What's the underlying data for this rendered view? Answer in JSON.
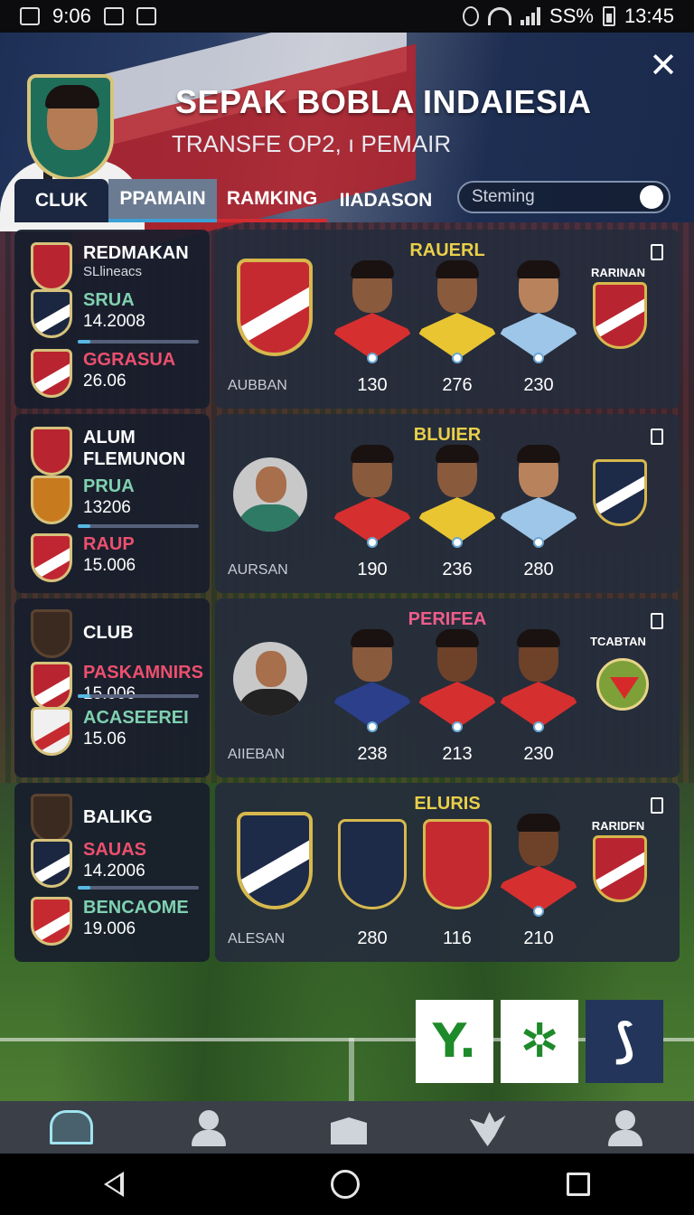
{
  "status_bar": {
    "time_left": "9:06",
    "battery": "SS%",
    "time_right": "13:45"
  },
  "header": {
    "title": "SEPAK BOBLA INDAIESIA",
    "subtitle": "TRANSFE OP2, ı PEMAIR",
    "tabs": [
      "CLUK",
      "PPAMAIN",
      "RAMKING",
      "IIADASON"
    ],
    "toggle_label": "Steming",
    "toggle_on": true
  },
  "rows": [
    {
      "left": [
        {
          "name": "REDMAKAN",
          "sub": "SLlineacs",
          "color": "#b82530"
        },
        {
          "name": "SRUA",
          "value": "14.2008",
          "name_color": "green",
          "color": "#1b2740"
        },
        {
          "name": "GGRASUA",
          "value": "26.06",
          "name_color": "pink",
          "color": "#b82530"
        }
      ],
      "right": {
        "title": "RAUERL",
        "caption": "AUBBAN",
        "club": "RARINAN",
        "numbers": [
          "130",
          "276",
          "230"
        ]
      }
    },
    {
      "left": [
        {
          "name": "ALUM",
          "sub": "FLEMUNON",
          "color": "#b82530"
        },
        {
          "name": "PRUA",
          "value": "13206",
          "name_color": "green",
          "color": "#c87a1e"
        },
        {
          "name": "RAUP",
          "value": "15.006",
          "name_color": "pink",
          "color": "#c02631"
        }
      ],
      "right": {
        "title": "BLUIER",
        "caption": "AURSAN",
        "club": "",
        "numbers": [
          "190",
          "236",
          "280"
        ]
      }
    },
    {
      "left": [
        {
          "name": "CLUB",
          "sub": "",
          "color": "#3a2a20"
        },
        {
          "name": "PASKAMNIRS",
          "value": "15.006",
          "name_color": "pink",
          "color": "#b82530"
        },
        {
          "name": "ACASEEREI",
          "value": "15.06",
          "name_color": "green",
          "color": "#f0f0f0"
        }
      ],
      "right": {
        "title": "PERIFEA",
        "caption": "AIIEBAN",
        "club": "TCABTAN",
        "numbers": [
          "238",
          "213",
          "230"
        ]
      }
    },
    {
      "left": [
        {
          "name": "BALIKG",
          "sub": "",
          "color": "#3a2a20"
        },
        {
          "name": "SAUAS",
          "value": "14.2006",
          "name_color": "pink",
          "color": "#1b2740"
        },
        {
          "name": "BENCAOME",
          "value": "19.006",
          "name_color": "green",
          "color": "#c62a31"
        }
      ],
      "right": {
        "title": "ELURIS",
        "caption": "ALESAN",
        "club": "RARIDFN",
        "numbers": [
          "280",
          "116",
          "210"
        ]
      }
    }
  ],
  "actions": [
    {
      "glyph": "Y."
    },
    {
      "glyph": "✲"
    },
    {
      "glyph": "⟆"
    }
  ],
  "colors": {
    "accent_gold": "#e9cf4a",
    "accent_pink": "#ef5c8a",
    "tab_active_underline": "#d32b32"
  }
}
